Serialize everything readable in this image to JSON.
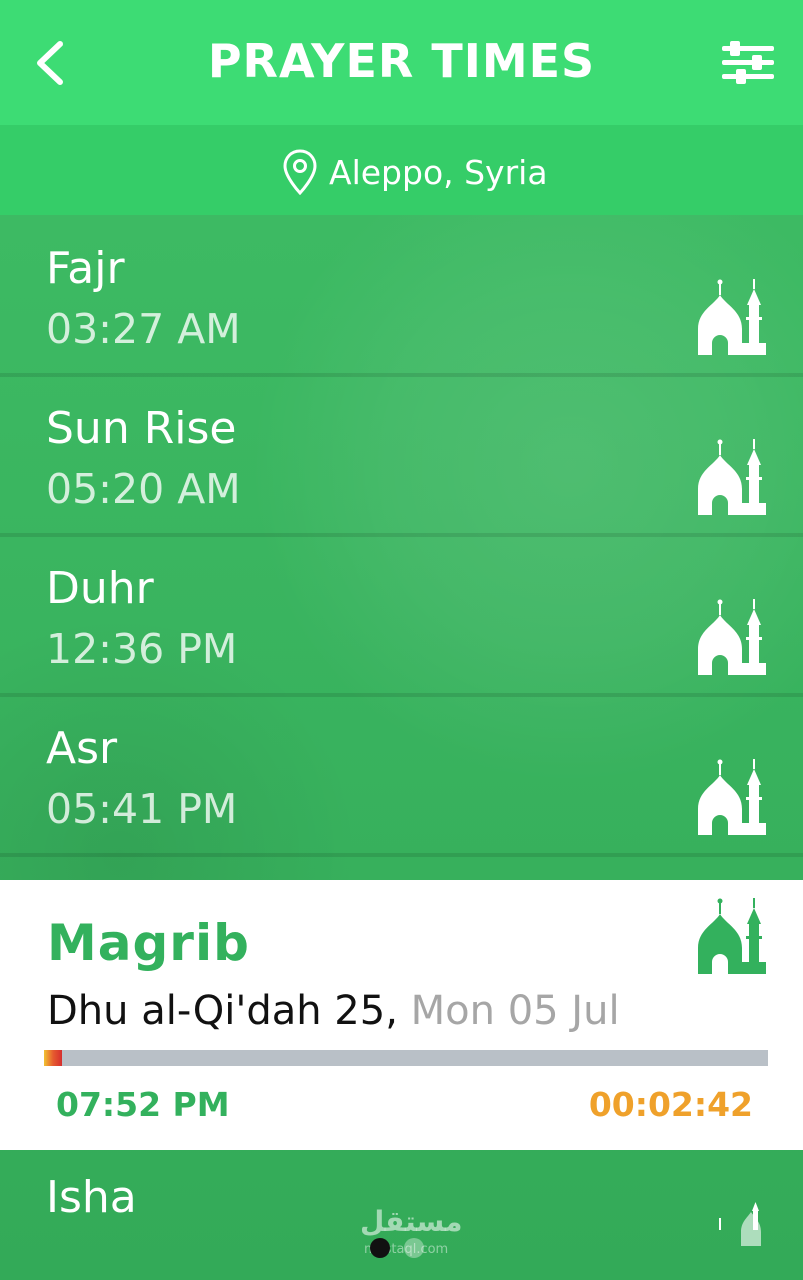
{
  "header": {
    "title": "PRAYER TIMES",
    "back_icon": "chevron-left-icon",
    "filters_icon": "sliders-icon"
  },
  "location": {
    "icon": "location-pin-icon",
    "label": "Aleppo, Syria"
  },
  "prayers": [
    {
      "name": "Fajr",
      "time": "03:27 AM"
    },
    {
      "name": "Sun Rise",
      "time": "05:20 AM"
    },
    {
      "name": "Duhr",
      "time": "12:36 PM"
    },
    {
      "name": "Asr",
      "time": "05:41 PM"
    }
  ],
  "current": {
    "name": "Magrib",
    "hijri": "Dhu al-Qi'dah 25,",
    "gregorian": "Mon 05 Jul",
    "time": "07:52 PM",
    "countdown": "00:02:42",
    "progress": 0.025
  },
  "next": {
    "name": "Isha"
  },
  "pager": {
    "current_page": 1,
    "total_pages": 2
  },
  "watermark": {
    "text": "مستقل",
    "sub": "mostaql.com"
  },
  "colors": {
    "header": "#3ddc74",
    "accent": "#33b15d",
    "countdown": "#efa12b",
    "progress_track": "#b9c0c7"
  }
}
